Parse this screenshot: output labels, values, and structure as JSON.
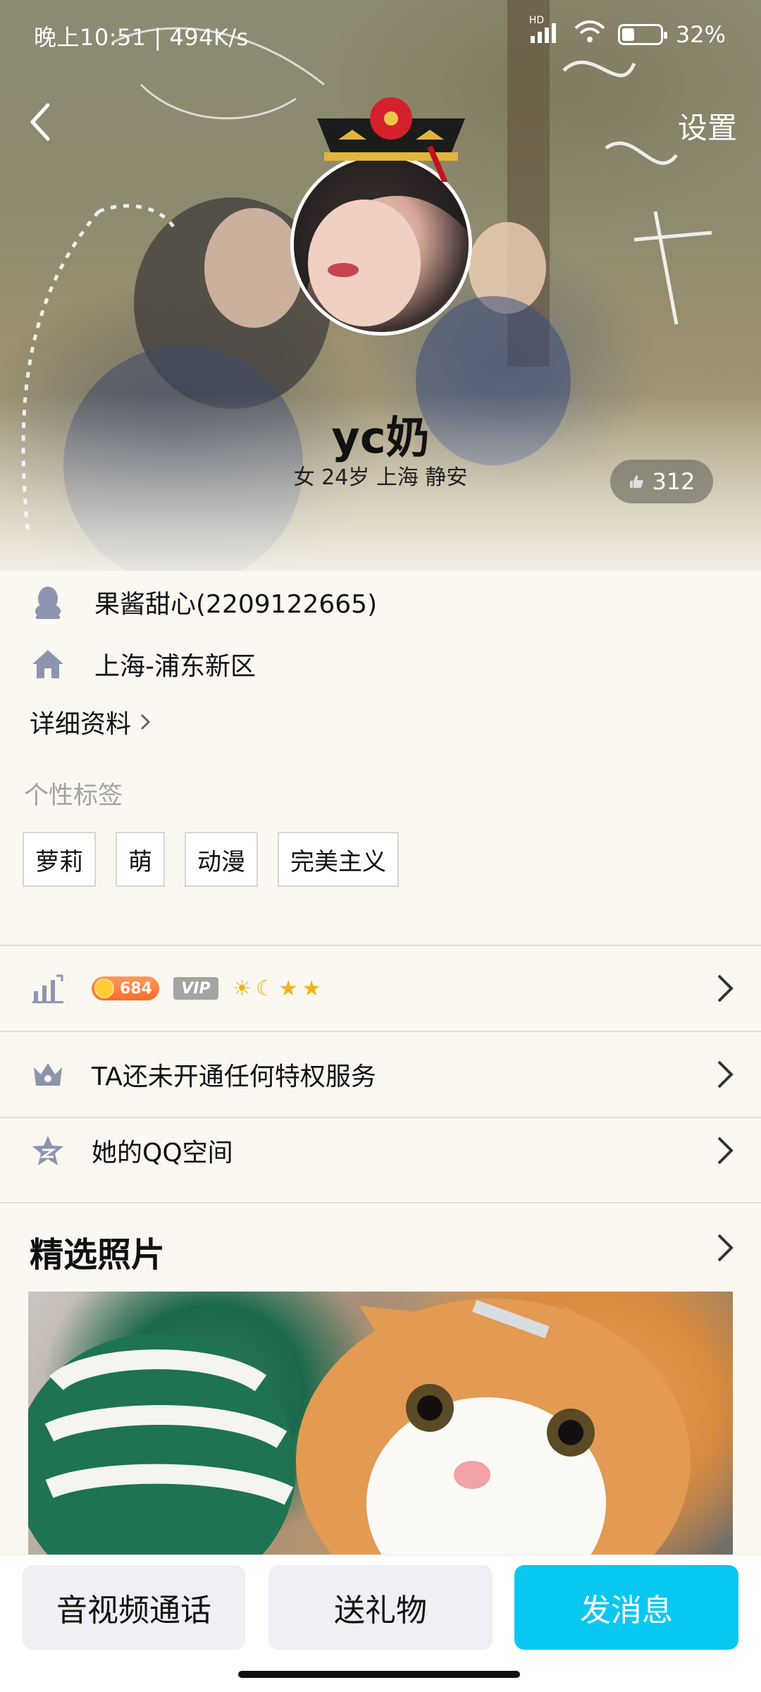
{
  "status_bar": {
    "time": "晚上10:51 | 494K/s",
    "network": "HD",
    "battery_text": "32%",
    "battery_level": 0.32
  },
  "nav": {
    "settings_label": "设置"
  },
  "profile": {
    "nickname": "yc奶",
    "subinfo": "女 24岁 上海 静安",
    "likes": "312"
  },
  "info": {
    "qq_name": "果酱甜心(2209122665)",
    "location": "上海-浦东新区",
    "details_link": "详细资料"
  },
  "tags": {
    "title": "个性标签",
    "items": [
      "萝莉",
      "萌",
      "动漫",
      "完美主义"
    ]
  },
  "rows": {
    "level_coin": "684",
    "vip_label": "VIP",
    "privilege": "TA还未开通任何特权服务",
    "qzone": "她的QQ空间"
  },
  "photos": {
    "title": "精选照片"
  },
  "actions": {
    "call": "音视频通话",
    "gift": "送礼物",
    "message": "发消息"
  },
  "colors": {
    "accent": "#08c8f2",
    "coin": "#ff6b2b"
  }
}
